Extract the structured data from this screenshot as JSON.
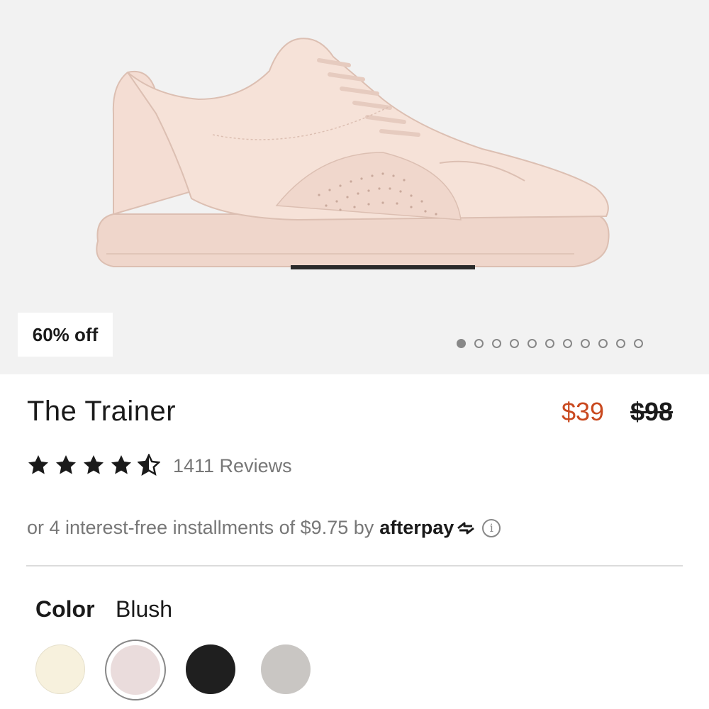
{
  "product": {
    "badge": "60% off",
    "title": "The Trainer",
    "sale_price": "$39",
    "original_price": "$98",
    "rating": 4.5,
    "rating_max": 5,
    "reviews": "1411 Reviews",
    "installments_text": "or 4 interest-free installments of $9.75 by",
    "afterpay_label": "afterpay",
    "info_icon": "info-icon"
  },
  "gallery": {
    "total_images": 11,
    "active_index": 0
  },
  "color": {
    "label": "Color",
    "selected": "Blush",
    "swatches": [
      {
        "name": "cream",
        "hex": "#f7f1dd"
      },
      {
        "name": "blush",
        "hex": "#eadcdc",
        "selected": true
      },
      {
        "name": "black",
        "hex": "#1f1f1f"
      },
      {
        "name": "grey",
        "hex": "#c9c6c3"
      }
    ]
  },
  "colors": {
    "accent_sale": "#c9491f",
    "hero_bg": "#f2f2f2",
    "shoe": "#f3dcd2"
  }
}
